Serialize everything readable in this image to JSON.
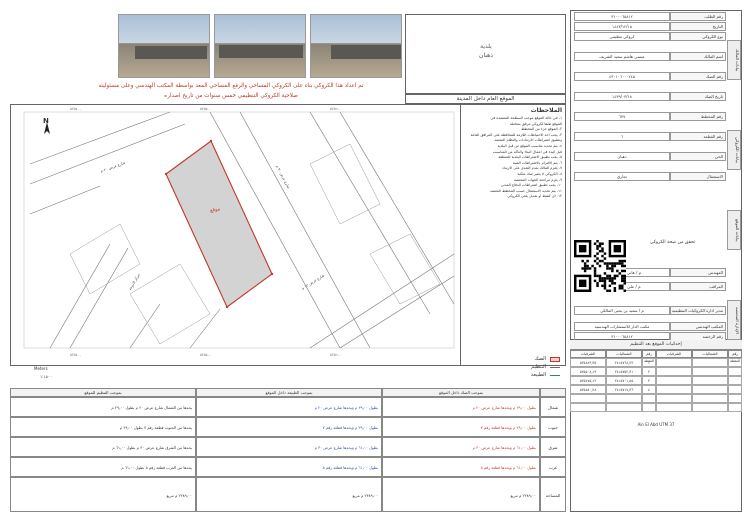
{
  "header_note_line1": "تم اعداد هذا الكروكي بناء على الكروكي المساحي والرفع المساحي المعد بواسطة المكتب الهندسي وعلى مسئوليته",
  "header_note_line2": "صلاحية الكروكي التنظيمي خمس سنوات من تاريخ اصداره",
  "location_title": "الموقع العام داخل المدينة",
  "municipality_label": "بلدية",
  "municipality_name": "ذهبان",
  "notes_title": "الملاحظات",
  "notes_lines": [
    "١- في حالة الموقع موجب السطحة المعتمدة في",
    "الموقع طبقا لكروكي مرفق بمعاملة",
    "٢- الموقع جزء من المخطط",
    "٣- يجب اخذ الاحتياطات اللازمة للمحافظة على المرافق العامة",
    "وتطبيق اشتراطات الارتدادات والنظام المعتمد",
    "٤- يتم تحديد مناسيب الموقع من قبل البلدية",
    "قبل البدء في اعمال البناء والتأكد من المناسيب",
    "٥- يجب تطبيق الاشتراطات البلدية للمنطقة",
    "٦- يتم الالتزام بالاشتراطات الفنية",
    "٧- يلتزم المالك بعدم التعدي على الارتداد",
    "٨- الكروكي لا يعتبر صك ملكية",
    "٩- يلزم مراجعة الجهات المختصة",
    "١٠- يجب تطبيق اشتراطات الدفاع المدني",
    "١١- يتم تحديد الاستعمال حسب المخطط المعتمد",
    "١٢- اي كشط او تعديل يلغي الكروكي"
  ],
  "site_label": "موقع",
  "north_label": "N",
  "scale_label": "مقياس الرسم",
  "legend": {
    "items": [
      {
        "label": "الصك",
        "color": "#c0392b"
      },
      {
        "label": "التنظيم",
        "color": "#6a6a6a"
      },
      {
        "label": "الطبيعة",
        "color": "#2e8b57"
      }
    ]
  },
  "meters_label": "Meters",
  "meters_value": "١:١٥٠٠",
  "streets": [
    "شارع عرض ٢٠ م",
    "شارع عرض ٣٠ م",
    "مركز الدوحة",
    "شارع عرض ١٢ م"
  ],
  "bottom_table": {
    "headers": [
      "بموجب التنظيم للموقع",
      "بموجب الطبيعة داخل الموقع",
      "بموجب الصك داخل الموقع"
    ],
    "side_labels": [
      "شمال",
      "جنوب",
      "شرق",
      "غرب"
    ],
    "rows": [
      [
        "يحدها من الشمال شارع عرض ٢٠ م بطول ٢٩٫٠٠ م",
        "بطول ٢٩٫٠٠ م ويحدها شارع عرض ٢٠ م",
        "بطول ٢٩٫٠٠ م ويحدها شارع عرض ٢٠ م"
      ],
      [
        "يحدها من الجنوب قطعة رقم ٧ بطول ٢٩٫٠٠ م",
        "بطول ٢٩٫٠٠ م ويحدها قطعة رقم ٧",
        "بطول ٢٩٫٠٠ م ويحدها قطعة رقم ٧"
      ],
      [
        "يحدها من الشرق شارع عرض ٣٠ م بطول ٦١٫٠٠ م",
        "بطول ٦١٫٠٠ م ويحدها شارع عرض ٣٠ م",
        "بطول ٦١٫٠٠ م ويحدها شارع عرض ٣٠ م"
      ],
      [
        "يحدها من الغرب قطعة رقم ٥ بطول ٦١٫٠٠ م",
        "بطول ٦١٫٠٠ م ويحدها قطعة رقم ٥",
        "بطول ٦١٫٠٠ م ويحدها قطعة رقم ٥"
      ]
    ],
    "area_row": [
      "٢٣٨٩٫٠٠ م مربع",
      "٢٣٨٩٫٠٠ م مربع",
      "٢٣٨٩٫٠٠ م مربع"
    ],
    "area_label": "المساحة"
  },
  "right_panel": {
    "ref_label": "رقم الطلب",
    "ref_value": "٣١٠٠٠٦٥٨١٢",
    "date_label": "التاريخ",
    "date_value": "١٤٤٣/١٢/١٥",
    "type_label": "نوع الكروكي",
    "type_value": "كروكي تنظيمي",
    "owner_label": "اسم المالك",
    "owner_value": "عيسى هاشم سعيد الشريف",
    "deed_label": "رقم الصك",
    "deed_value": "٤٣٠١٠٦٠٠٠٢٤٥",
    "deed_date_label": "تاريخ الصك",
    "deed_date_value": "١٤٣٩/٠٣/١٨",
    "plan_label": "رقم المخطط",
    "plan_value": "٦٧٧",
    "plot_label": "رقم القطعة",
    "plot_value": "٦",
    "district_label": "الحي",
    "district_value": "ذهبان",
    "usage_label": "الاستعمال",
    "usage_value": "تجاري",
    "scan_caption": "تحقق من صحة الكروكي",
    "engineer_label": "المهندس",
    "engineer_value": "م / هاني علي الزهراني",
    "surveyor_label": "المراقب",
    "surveyor_value": "م / علي صالح الغامدي",
    "director_label": "مدير ادارة الكروكيات التنظيمية",
    "director_value": "م / سعيد بن يحيى المالكي",
    "office_label": "المكتب الهندسي",
    "office_value": "مكتب الدار للاستشارات الهندسية",
    "permit_label": "رقم الرخصة",
    "permit_value": "٣١٠٠٠٦٥٨١٢",
    "side_labels": [
      "بيانات المالك",
      "بيانات الكروكي",
      "بيانات الموقع",
      "الإدارة المختصة"
    ]
  },
  "coords_title": "إحداثيات الموقع بعد التنظيم",
  "coords_headers": [
    "الشرقيات",
    "الشماليات",
    "رقم النقطة",
    "الشرقيات",
    "الشماليات",
    "رقم النقطة"
  ],
  "coords_rows": [
    [
      "٥٢٥٤٨٣٫٣٥",
      "٢٤١٥٧٦٨٫٢٢",
      "١",
      "",
      "",
      ""
    ],
    [
      "٥٢٥٥٠٨٫١٩",
      "٢٤١٥٧٥٢٫٣١",
      "٢",
      "",
      "",
      ""
    ],
    [
      "٥٢٥٤٧٥٫١٢",
      "٢٤١٥٧٠١٫٤٥",
      "٣",
      "",
      "",
      ""
    ],
    [
      "٥٢٥٤٥٠٫٢٨",
      "٢٤١٥٧١٧٫٣٦",
      "٤",
      "",
      "",
      ""
    ],
    [
      "",
      "",
      "",
      "",
      "",
      ""
    ],
    [
      "",
      "",
      "",
      "",
      "",
      ""
    ]
  ],
  "coords_system": "Ain El Abd UTM 37"
}
